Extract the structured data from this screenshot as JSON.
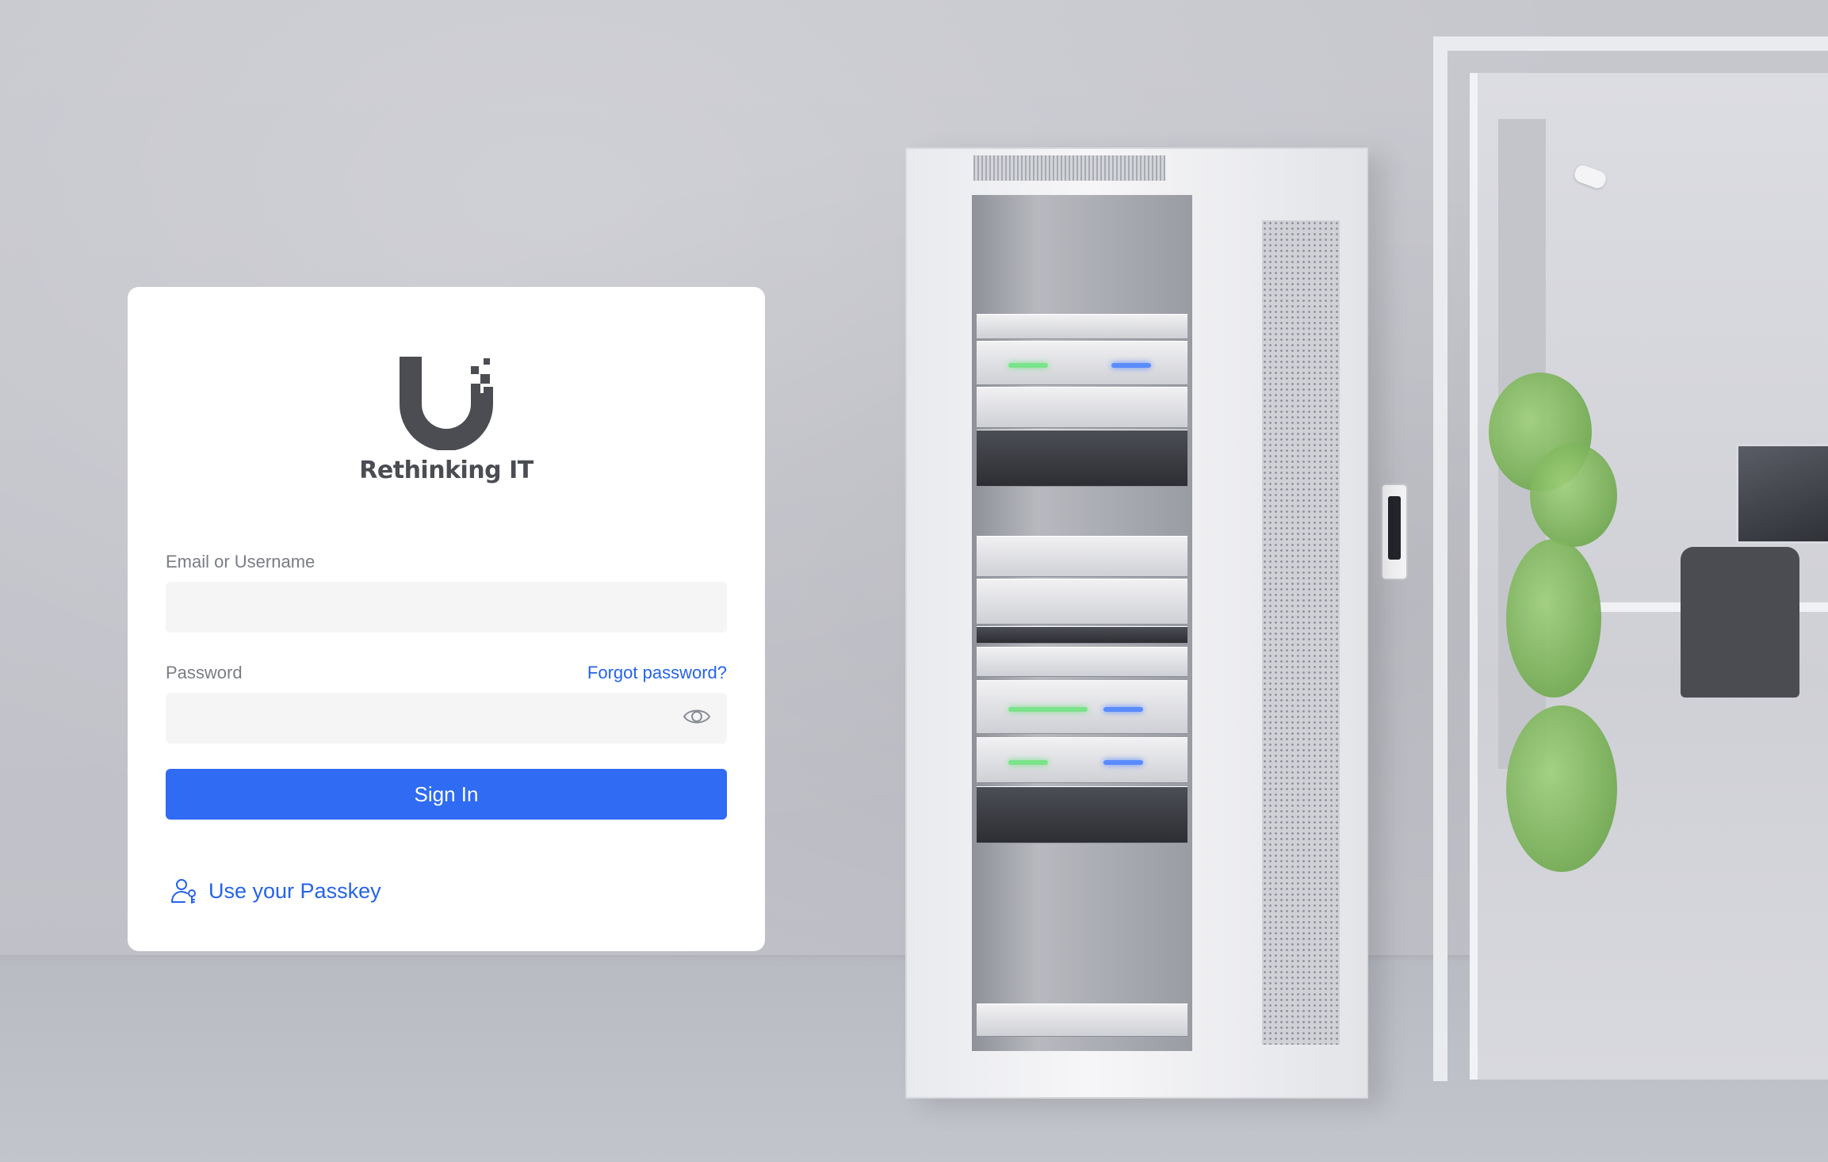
{
  "brand": {
    "logo_text": "Rethinking IT",
    "logo_icon": "ubiquiti-u-icon"
  },
  "form": {
    "email_label": "Email or Username",
    "email_value": "",
    "password_label": "Password",
    "password_value": "",
    "forgot_password": "Forgot password?",
    "sign_in_label": "Sign In",
    "passkey_label": "Use your Passkey"
  },
  "icons": {
    "show_password": "eye-icon",
    "passkey": "user-key-icon"
  },
  "colors": {
    "accent": "#2f6bf3",
    "link": "#2563eb",
    "logo": "#4b4d53",
    "input_bg": "#f5f5f6"
  }
}
